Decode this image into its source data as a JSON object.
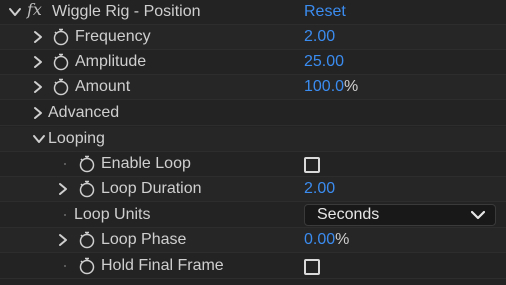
{
  "effect": {
    "title": "Wiggle Rig - Position",
    "reset_label": "Reset",
    "fx_label": "fx"
  },
  "rows": {
    "frequency": {
      "label": "Frequency",
      "value": "2.00"
    },
    "amplitude": {
      "label": "Amplitude",
      "value": "25.00"
    },
    "amount": {
      "label": "Amount",
      "value": "100.0",
      "unit": "%"
    },
    "advanced": {
      "label": "Advanced"
    },
    "looping": {
      "label": "Looping"
    },
    "enable_loop": {
      "label": "Enable Loop",
      "checked": false
    },
    "loop_duration": {
      "label": "Loop Duration",
      "value": "2.00"
    },
    "loop_units": {
      "label": "Loop Units",
      "selected": "Seconds"
    },
    "loop_phase": {
      "label": "Loop Phase",
      "value": "0.00",
      "unit": "%"
    },
    "hold_final_frame": {
      "label": "Hold Final Frame",
      "checked": false
    }
  },
  "colors": {
    "background": "#232323",
    "value_blue": "#3b8cf0",
    "label_text": "#cfcfcf"
  }
}
